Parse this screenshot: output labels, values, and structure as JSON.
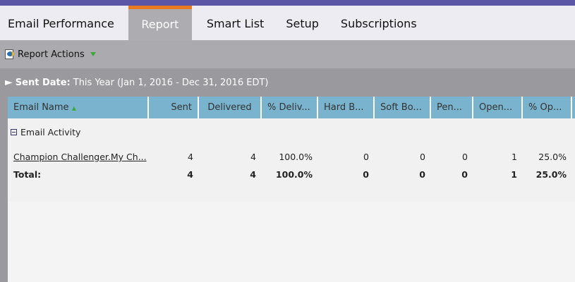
{
  "tabs": [
    "Email Performance",
    "Report",
    "Smart List",
    "Setup",
    "Subscriptions"
  ],
  "toolbar": {
    "report_actions": "Report Actions"
  },
  "filter": {
    "label": "Sent Date:",
    "value": "This Year (Jan 1, 2016 - Dec 31, 2016 EDT)"
  },
  "columns": [
    "Email Name",
    "Sent",
    "Delivered",
    "% Deliv...",
    "Hard B...",
    "Soft Bo...",
    "Pen...",
    "Open...",
    "% Op..."
  ],
  "group": "Email Activity",
  "rows": [
    [
      "Champion Challenger.My Ch...",
      "4",
      "4",
      "100.0%",
      "0",
      "0",
      "0",
      "1",
      "25.0%"
    ]
  ],
  "total": [
    "Total:",
    "4",
    "4",
    "100.0%",
    "0",
    "0",
    "0",
    "1",
    "25.0%"
  ]
}
